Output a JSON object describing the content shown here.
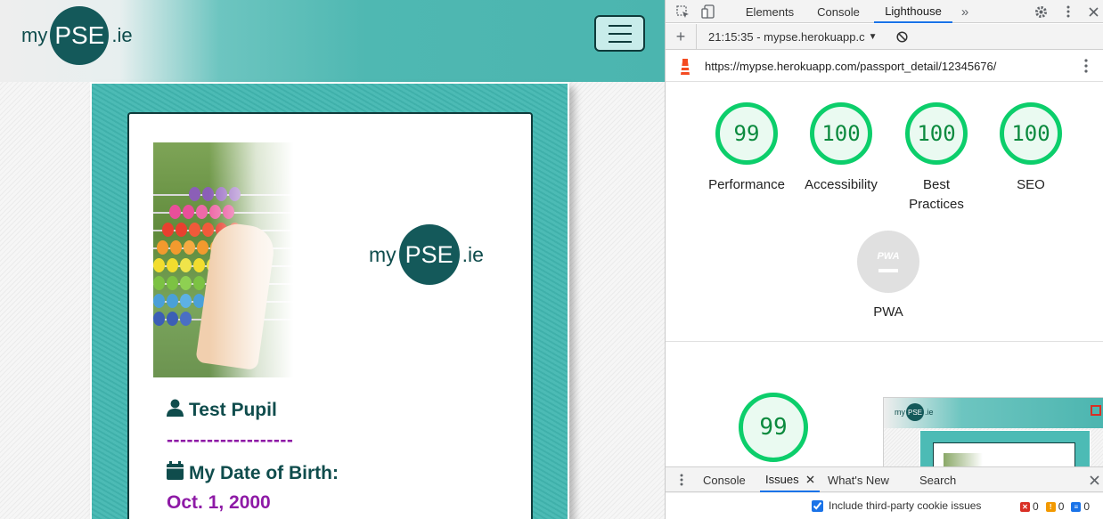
{
  "site": {
    "header_logo": {
      "prefix": "my",
      "brand": "PSE",
      "suffix": ".ie"
    },
    "card_logo": {
      "prefix": "my",
      "brand": "PSE",
      "suffix": ".ie"
    },
    "pupil_name": "Test Pupil",
    "separator": "-------------------",
    "dob_label": "My Date of Birth:",
    "dob_value": "Oct. 1, 2000"
  },
  "devtools": {
    "tabs": [
      "Elements",
      "Console",
      "Lighthouse"
    ],
    "active_tab": "Lighthouse",
    "more_tabs_glyph": "»",
    "report_select": "21:15:35 - mypse.herokuapp.c",
    "url": "https://mypse.herokuapp.com/passport_detail/12345676/",
    "scores": [
      {
        "label": "Performance",
        "value": "99"
      },
      {
        "label": "Accessibility",
        "value": "100"
      },
      {
        "label": "Best Practices",
        "value": "100"
      },
      {
        "label": "SEO",
        "value": "100"
      }
    ],
    "pwa": {
      "badge": "PWA",
      "label": "PWA"
    },
    "performance_gauge": "99",
    "thumbnail_logo": {
      "prefix": "my",
      "brand": "PSE",
      "suffix": ".ie"
    },
    "drawer": {
      "tabs": [
        "Console",
        "Issues",
        "What's New",
        "Search"
      ],
      "active_tab": "Issues",
      "checkbox_label": "Include third-party cookie issues",
      "checkbox_checked": true,
      "errors": "0",
      "warnings": "0",
      "infos": "0"
    },
    "colors": {
      "pass": "#0cce6b",
      "accent": "#1a73e8",
      "brand": "#14595a",
      "date": "#8e1aa6"
    }
  }
}
